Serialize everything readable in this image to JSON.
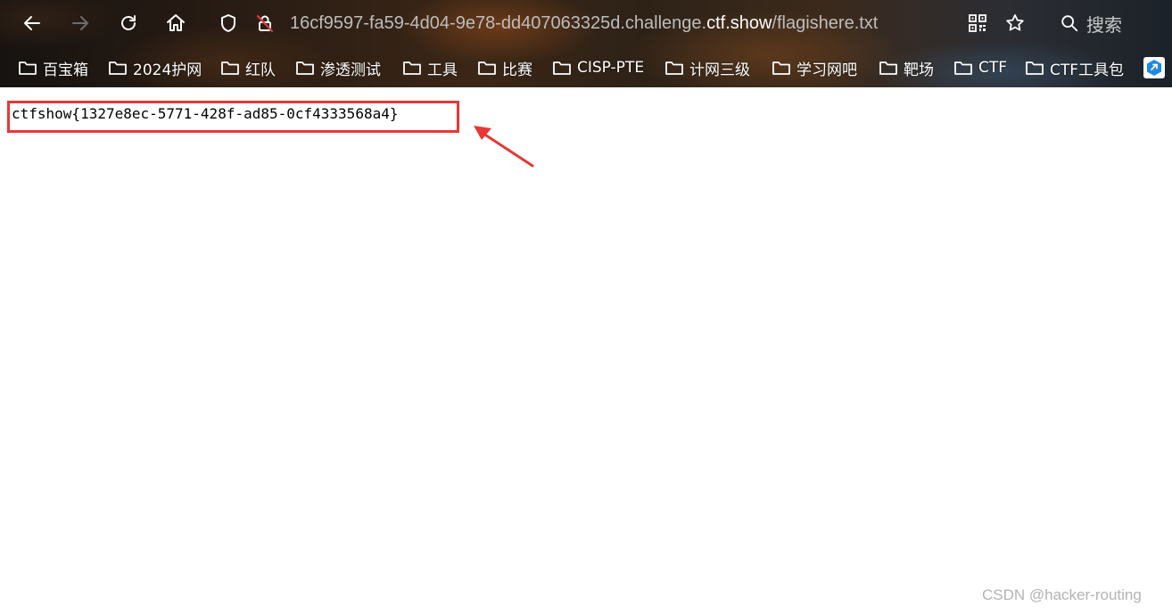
{
  "browser": {
    "url_prefix": "16cf9597-fa59-4d04-9e78-dd407063325d.challenge.",
    "url_host": "ctf.show",
    "url_path": "/flagishere.txt",
    "search_label": "搜索"
  },
  "bookmarks": [
    {
      "label": "百宝箱"
    },
    {
      "label": "2024护网"
    },
    {
      "label": "红队"
    },
    {
      "label": "渗透测试"
    },
    {
      "label": "工具"
    },
    {
      "label": "比赛"
    },
    {
      "label": "CISP-PTE"
    },
    {
      "label": "计网三级"
    },
    {
      "label": "学习网吧"
    },
    {
      "label": "靶场"
    },
    {
      "label": "CTF"
    },
    {
      "label": "CTF工具包"
    }
  ],
  "page": {
    "flag_text": "ctfshow{1327e8ec-5771-428f-ad85-0cf4333568a4}"
  },
  "annotation": {
    "highlight_color": "#e53935"
  },
  "watermark": "CSDN @hacker-routing"
}
